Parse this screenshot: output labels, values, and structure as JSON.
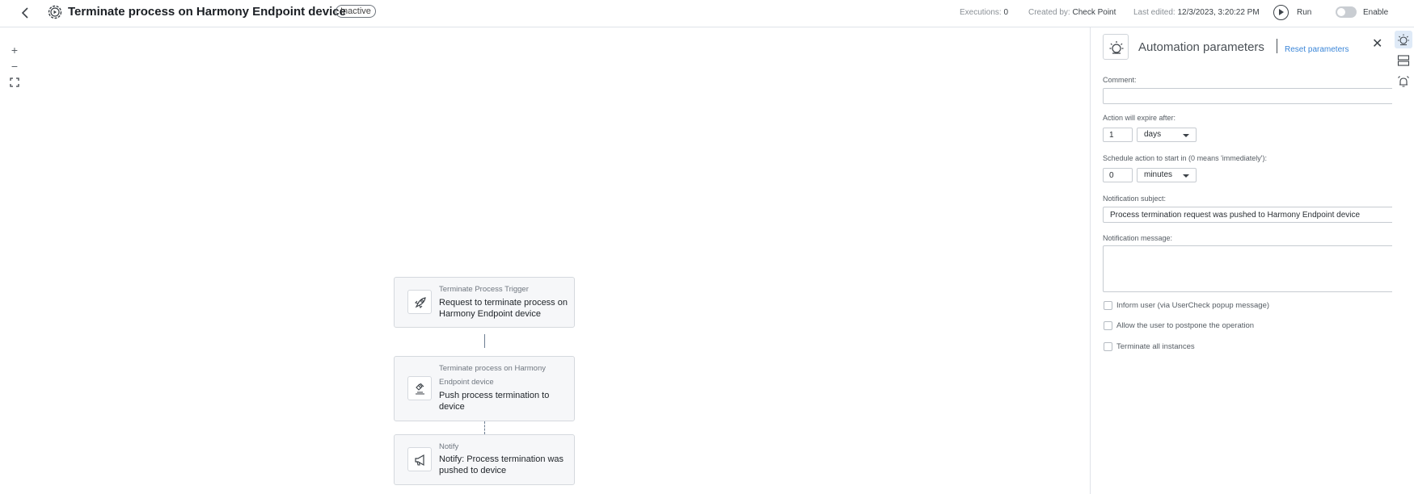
{
  "header": {
    "title": "Terminate process on Harmony Endpoint device",
    "status_badge": "Inactive",
    "executions_label": "Executions:",
    "executions_value": "0",
    "created_by_label": "Created by:",
    "created_by_value": "Check Point",
    "last_edited_label": "Last edited:",
    "last_edited_value": "12/3/2023, 3:20:22 PM",
    "run_label": "Run",
    "enable_label": "Enable",
    "enabled": false
  },
  "zoom_controls": {
    "zoom_in": "+",
    "zoom_out": "−"
  },
  "workflow": {
    "nodes": [
      {
        "type": "Terminate Process Trigger",
        "description": "Request to terminate process on Harmony Endpoint device",
        "icon": "rocket-icon"
      },
      {
        "type": "Terminate process on Harmony Endpoint device",
        "description": "Push process termination to device",
        "icon": "gavel-icon"
      },
      {
        "type": "Notify",
        "description": "Notify: Process termination was pushed to device",
        "icon": "megaphone-icon"
      }
    ]
  },
  "panel": {
    "title": "Automation parameters",
    "reset_label": "Reset parameters",
    "comment_label": "Comment:",
    "comment_value": "",
    "expire_label": "Action will expire after:",
    "expire_value": "1",
    "expire_unit": "days",
    "schedule_label": "Schedule action to start in (0 means 'immediately'):",
    "schedule_value": "0",
    "schedule_unit": "minutes",
    "subject_label": "Notification subject:",
    "subject_value": "Process termination request was pushed to Harmony Endpoint device",
    "message_label": "Notification message:",
    "message_value": "",
    "checkboxes": [
      {
        "label": "Inform user (via UserCheck popup message)",
        "checked": false
      },
      {
        "label": "Allow the user to postpone the operation",
        "checked": false
      },
      {
        "label": "Terminate all instances",
        "checked": false
      }
    ]
  },
  "colors": {
    "accent": "#3b86d8",
    "connector": "#6d7e92"
  }
}
